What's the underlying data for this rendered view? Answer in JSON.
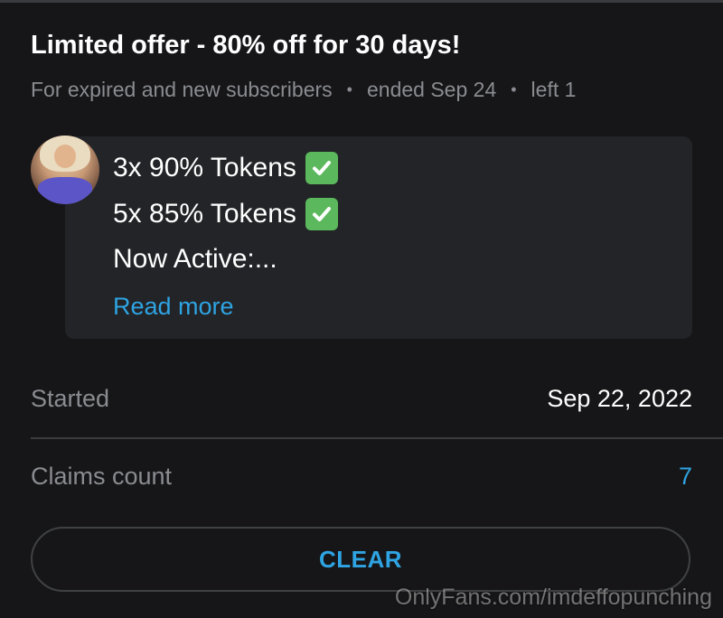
{
  "promo": {
    "title": "Limited offer - 80% off for 30 days!",
    "meta": {
      "audience": "For expired and new subscribers",
      "ended": "ended Sep 24",
      "left": "left 1"
    },
    "message": {
      "lines": [
        {
          "text": "3x 90% Tokens",
          "has_check": true
        },
        {
          "text": "5x 85% Tokens",
          "has_check": true
        },
        {
          "text": "Now Active:...",
          "has_check": false
        }
      ],
      "read_more": "Read more"
    },
    "details": {
      "started_label": "Started",
      "started_value": "Sep 22, 2022",
      "claims_label": "Claims count",
      "claims_value": "7"
    },
    "clear_label": "CLEAR"
  },
  "watermark": "OnlyFans.com/imdeffopunching",
  "icons": {
    "check": "check-mark-box-icon",
    "separator": "bullet-dot"
  },
  "colors": {
    "background": "#161618",
    "bubble": "#222427",
    "accent": "#2fa4e3",
    "muted_text": "#8a8c91",
    "check_green": "#5cb85c"
  }
}
